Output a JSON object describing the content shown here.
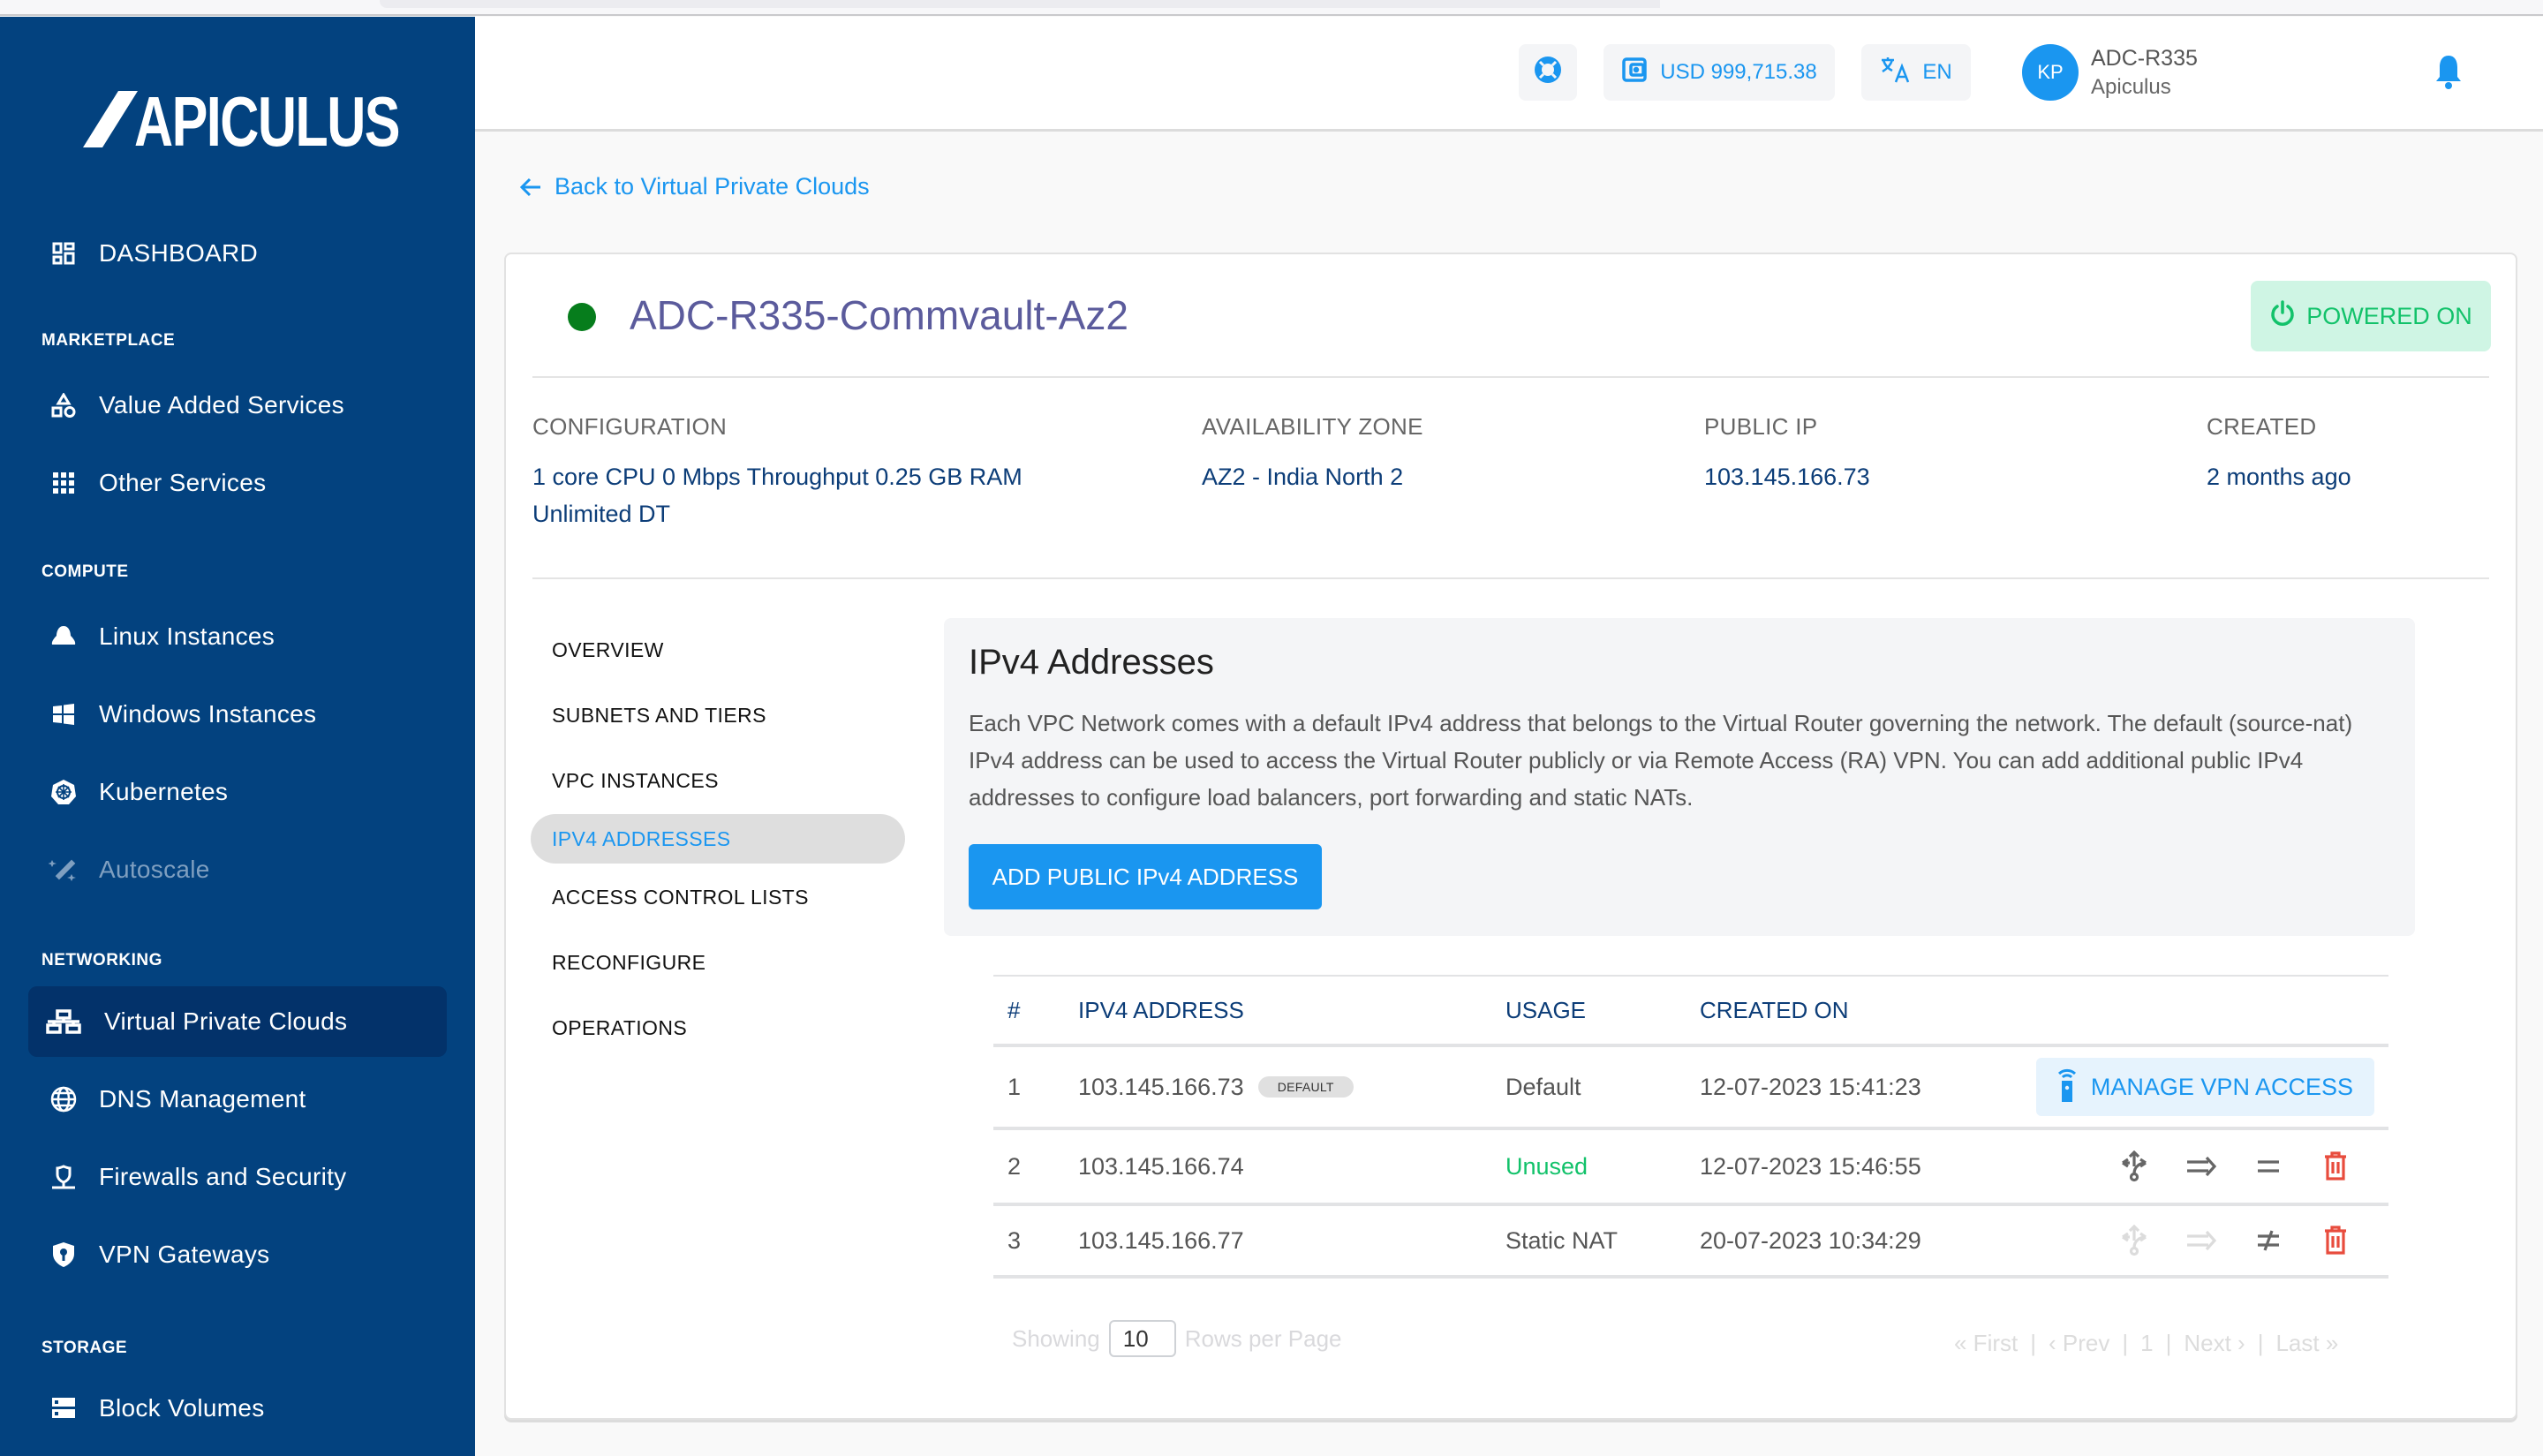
{
  "brand": {
    "name": "APICULUS"
  },
  "header": {
    "balance": "USD 999,715.38",
    "language": "EN",
    "user_initials": "KP",
    "user_name": "ADC-R335",
    "user_org": "Apiculus"
  },
  "sidebar": {
    "dashboard": "DASHBOARD",
    "sections": {
      "marketplace": "MARKETPLACE",
      "compute": "COMPUTE",
      "networking": "NETWORKING",
      "storage": "STORAGE"
    },
    "items": {
      "value_added": "Value Added Services",
      "other_services": "Other Services",
      "linux": "Linux Instances",
      "windows": "Windows Instances",
      "kubernetes": "Kubernetes",
      "autoscale": "Autoscale",
      "vpc": "Virtual Private Clouds",
      "dns": "DNS Management",
      "firewalls": "Firewalls and Security",
      "vpn": "VPN Gateways",
      "block_volumes": "Block Volumes"
    }
  },
  "back_link": "Back to Virtual Private Clouds",
  "vpc": {
    "name": "ADC-R335-Commvault-Az2",
    "status": "POWERED ON",
    "status_color": "#12c26a",
    "info": {
      "configuration_label": "CONFIGURATION",
      "configuration_value": "1 core CPU 0 Mbps Throughput 0.25 GB RAM Unlimited DT",
      "zone_label": "AVAILABILITY ZONE",
      "zone_value": "AZ2 - India North 2",
      "ip_label": "PUBLIC IP",
      "ip_value": "103.145.166.73",
      "created_label": "CREATED",
      "created_value": "2 months ago"
    }
  },
  "subtabs": [
    "OVERVIEW",
    "SUBNETS AND TIERS",
    "VPC INSTANCES",
    "IPV4 ADDRESSES",
    "ACCESS CONTROL LISTS",
    "RECONFIGURE",
    "OPERATIONS"
  ],
  "active_subtab": "IPV4 ADDRESSES",
  "panel": {
    "title": "IPv4 Addresses",
    "description": "Each VPC Network comes with a default IPv4 address that belongs to the Virtual Router governing the network. The default (source-nat) IPv4 address can be used to access the Virtual Router publicly or via Remote Access (RA) VPN. You can add additional public IPv4 addresses to configure load balancers, port forwarding and static NATs.",
    "add_button": "ADD PUBLIC IPv4 ADDRESS"
  },
  "table": {
    "columns": [
      "#",
      "IPV4 ADDRESS",
      "USAGE",
      "CREATED ON"
    ],
    "rows": [
      {
        "num": "1",
        "ip": "103.145.166.73",
        "tag": "DEFAULT",
        "usage": "Default",
        "created": "12-07-2023 15:41:23",
        "action": "MANAGE VPN ACCESS"
      },
      {
        "num": "2",
        "ip": "103.145.166.74",
        "usage": "Unused",
        "created": "12-07-2023 15:46:55"
      },
      {
        "num": "3",
        "ip": "103.145.166.77",
        "usage": "Static NAT",
        "created": "20-07-2023 10:34:29"
      }
    ]
  },
  "pagination": {
    "showing": "Showing",
    "rows_per_page_value": "10",
    "rows_per_page": "Rows per Page",
    "first": "« First",
    "prev": "‹ Prev",
    "page": "1",
    "next": "Next ›",
    "last": "Last »",
    "sep": "|"
  }
}
